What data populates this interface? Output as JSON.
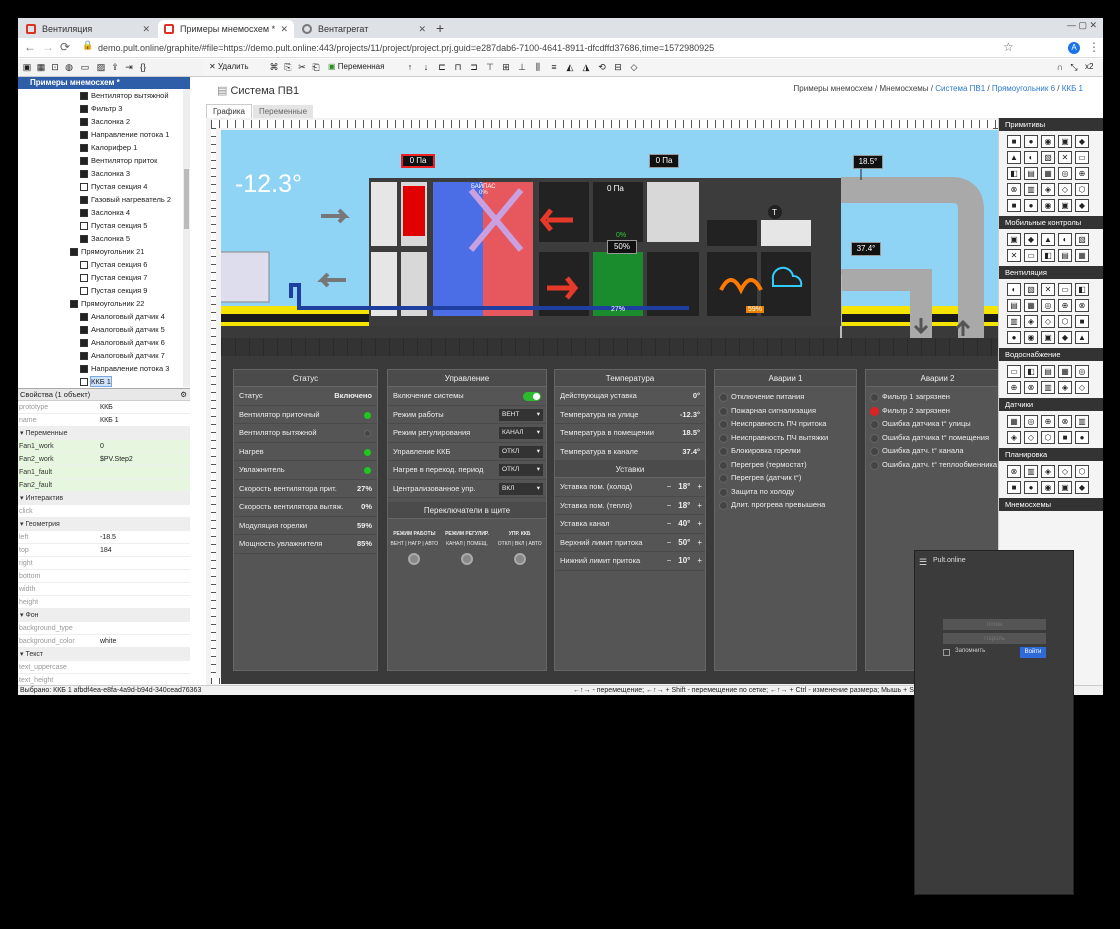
{
  "browser": {
    "tabs": [
      {
        "label": "Вентиляция"
      },
      {
        "label": "Примеры мнемосхем *"
      },
      {
        "label": "Вентагрегат"
      }
    ],
    "url": "demo.pult.online/graphite/#file=https://demo.pult.online:443/projects/11/project/project.prj.guid=e287dab6-7100-4641-8911-dfcdffd37686,time=1572980925",
    "zoom": "x2"
  },
  "toolbar": {
    "delete_label": "Удалить",
    "variable_label": "Переменная"
  },
  "tree": {
    "header": "Примеры мнемосхем *",
    "items": [
      {
        "label": "Вентилятор вытяжной",
        "dark": true
      },
      {
        "label": "Фильтр 3",
        "dark": true
      },
      {
        "label": "Заслонка 2",
        "dark": true
      },
      {
        "label": "Направление потока 1",
        "dark": true
      },
      {
        "label": "Калорифер 1",
        "dark": true
      },
      {
        "label": "Вентилятор приток",
        "dark": true
      },
      {
        "label": "Заслонка 3",
        "dark": true
      },
      {
        "label": "Пустая секция 4",
        "dark": false
      },
      {
        "label": "Газовый нагреватель 2",
        "dark": true
      },
      {
        "label": "Заслонка 4",
        "dark": true
      },
      {
        "label": "Пустая секция 5",
        "dark": false
      },
      {
        "label": "Заслонка 5",
        "dark": true
      },
      {
        "label": "Прямоугольник 21",
        "dark": true
      },
      {
        "label": "Пустая секция 6",
        "dark": false
      },
      {
        "label": "Пустая секция 7",
        "dark": false
      },
      {
        "label": "Пустая секция 9",
        "dark": false
      },
      {
        "label": "Прямоугольник 22",
        "dark": true
      },
      {
        "label": "Аналоговый датчик 4",
        "dark": true
      },
      {
        "label": "Аналоговый датчик 5",
        "dark": true
      },
      {
        "label": "Аналоговый датчик 6",
        "dark": true
      },
      {
        "label": "Аналоговый датчик 7",
        "dark": true
      },
      {
        "label": "Направление потока 3",
        "dark": true
      },
      {
        "label": "ККБ 1",
        "dark": false,
        "selected": true
      }
    ]
  },
  "properties": {
    "header": "Свойства (1 объект)",
    "rows": [
      {
        "k": "prototype",
        "v": "ККБ"
      },
      {
        "k": "name",
        "v": "ККБ 1"
      },
      {
        "group": "Переменные"
      },
      {
        "k": "Fan1_work",
        "v": "0",
        "green": true
      },
      {
        "k": "Fan2_work",
        "v": "$PV.Step2",
        "green": true
      },
      {
        "k": "Fan1_fault",
        "v": "",
        "green": true
      },
      {
        "k": "Fan2_fault",
        "v": "",
        "green": true
      },
      {
        "group": "Интерактив"
      },
      {
        "k": "click",
        "v": ""
      },
      {
        "group": "Геометрия"
      },
      {
        "k": "left",
        "v": "-18.5"
      },
      {
        "k": "top",
        "v": "184"
      },
      {
        "k": "right",
        "v": ""
      },
      {
        "k": "bottom",
        "v": ""
      },
      {
        "k": "width",
        "v": ""
      },
      {
        "k": "height",
        "v": ""
      },
      {
        "group": "Фон"
      },
      {
        "k": "background_type",
        "v": ""
      },
      {
        "k": "background_color",
        "v": "white"
      },
      {
        "group": "Текст"
      },
      {
        "k": "text_uppercase",
        "v": ""
      },
      {
        "k": "text_height",
        "v": ""
      }
    ]
  },
  "statusbar": {
    "left": "Выбрано: ККБ 1 afbdf4ea-e8fa-4a9d-b94d-340cead76363",
    "right": "←↑→ - перемещение; ←↑→ + Shift - перемещение по сетке; ←↑→ + Ctrl - изменение размера; Мышь + Shift - магнит"
  },
  "page": {
    "title": "Система ПВ1",
    "breadcrumbs": [
      "Примеры мнемосхем",
      "Мнемосхемы",
      "Система ПВ1",
      "Прямоугольник 6",
      "ККБ 1"
    ],
    "subtabs": [
      "Графика",
      "Переменные"
    ]
  },
  "scheme": {
    "outdoor_temp": "-12.3°",
    "pressure1": "0 Па",
    "pressure2": "0 Па",
    "pressure3": "0 Па",
    "bypass_label": "БАЙПАС",
    "bypass_value": "0%",
    "temp_out": "18.5°",
    "temp_ext": "37.4°",
    "fan_pct": "0%",
    "damper_pct": "50%",
    "fan2_pct": "27%",
    "burner_pct": "59%",
    "sensor_label": "T"
  },
  "status_panel": {
    "title": "Статус",
    "rows": [
      {
        "label": "Статус",
        "value": "Включено"
      },
      {
        "label": "Вентилятор приточный",
        "dot": "on"
      },
      {
        "label": "Вентилятор вытяжной",
        "dot": "off"
      },
      {
        "label": "Нагрев",
        "dot": "on"
      },
      {
        "label": "Увлажнитель",
        "dot": "on"
      },
      {
        "label": "Скорость вентилятора прит.",
        "value": "27%"
      },
      {
        "label": "Скорость вентилятора вытяж.",
        "value": "0%"
      },
      {
        "label": "Модуляция горелки",
        "value": "59%"
      },
      {
        "label": "Мощность увлажнителя",
        "value": "85%"
      }
    ]
  },
  "control_panel": {
    "title": "Управление",
    "rows": [
      {
        "label": "Включение системы",
        "toggle": true
      },
      {
        "label": "Режим работы",
        "select": "ВЕНТ"
      },
      {
        "label": "Режим регулирования",
        "select": "КАНАЛ"
      },
      {
        "label": "Управление ККБ",
        "select": "ОТКЛ"
      },
      {
        "label": "Нагрев в переход. период",
        "select": "ОТКЛ"
      },
      {
        "label": "Централизованное упр.",
        "select": "ВКЛ"
      }
    ],
    "switches_title": "Переключатели в щите",
    "switches": [
      {
        "title": "РЕЖИМ РАБОТЫ",
        "options": "ВЕНТ | НАГР | АВТО"
      },
      {
        "title": "РЕЖИМ РЕГУЛИР.",
        "options": "КАНАЛ | ПОМЕЩ."
      },
      {
        "title": "УПР. ККБ",
        "options": "ОТКЛ | ВКЛ | АВТО"
      }
    ]
  },
  "temp_panel": {
    "title": "Температура",
    "rows": [
      {
        "label": "Действующая уставка",
        "value": "0°"
      },
      {
        "label": "Температура на улице",
        "value": "-12.3°"
      },
      {
        "label": "Температура в помещении",
        "value": "18.5°"
      },
      {
        "label": "Температура в канале",
        "value": "37.4°"
      }
    ],
    "setpoints_title": "Уставки",
    "setpoints": [
      {
        "label": "Уставка пом. (холод)",
        "value": "18°"
      },
      {
        "label": "Уставка пом. (тепло)",
        "value": "18°"
      },
      {
        "label": "Уставка канал",
        "value": "40°"
      },
      {
        "label": "Верхний лимит притока",
        "value": "50°"
      },
      {
        "label": "Нижний лимит притока",
        "value": "10°"
      }
    ]
  },
  "alarms1": {
    "title": "Аварии 1",
    "items": [
      "Отключение питания",
      "Пожарная сигнализация",
      "Неисправность ПЧ притока",
      "Неисправность ПЧ вытяжки",
      "Блокировка горелки",
      "Перегрев (термостат)",
      "Перегрев (датчик t°)",
      "Защита по холоду",
      "Длит. прогрева превышена"
    ]
  },
  "alarms2": {
    "title": "Аварии 2",
    "items": [
      {
        "label": "Фильтр 1 загрязнен",
        "red": false
      },
      {
        "label": "Фильтр 2 загрязнен",
        "red": true
      },
      {
        "label": "Ошибка датчика t° улицы",
        "red": false
      },
      {
        "label": "Ошибка датчика t° помещения",
        "red": false
      },
      {
        "label": "Ошибка датч. t° канала",
        "red": false
      },
      {
        "label": "Ошибка датч. t° теплообменника",
        "red": false
      }
    ]
  },
  "palette": {
    "sections": [
      {
        "title": "Примитивы",
        "count": 25
      },
      {
        "title": "Мобильные контролы",
        "count": 10
      },
      {
        "title": "Вентиляция",
        "count": 20
      },
      {
        "title": "Водоснабжение",
        "count": 10
      },
      {
        "title": "Датчики",
        "count": 10
      },
      {
        "title": "Планировка",
        "count": 10
      },
      {
        "title": "Мнемосхемы",
        "count": 0
      }
    ]
  },
  "login": {
    "app": "Pult.online",
    "login_placeholder": "Логин",
    "password_placeholder": "Пароль",
    "remember": "Запомнить",
    "submit": "Войти"
  }
}
